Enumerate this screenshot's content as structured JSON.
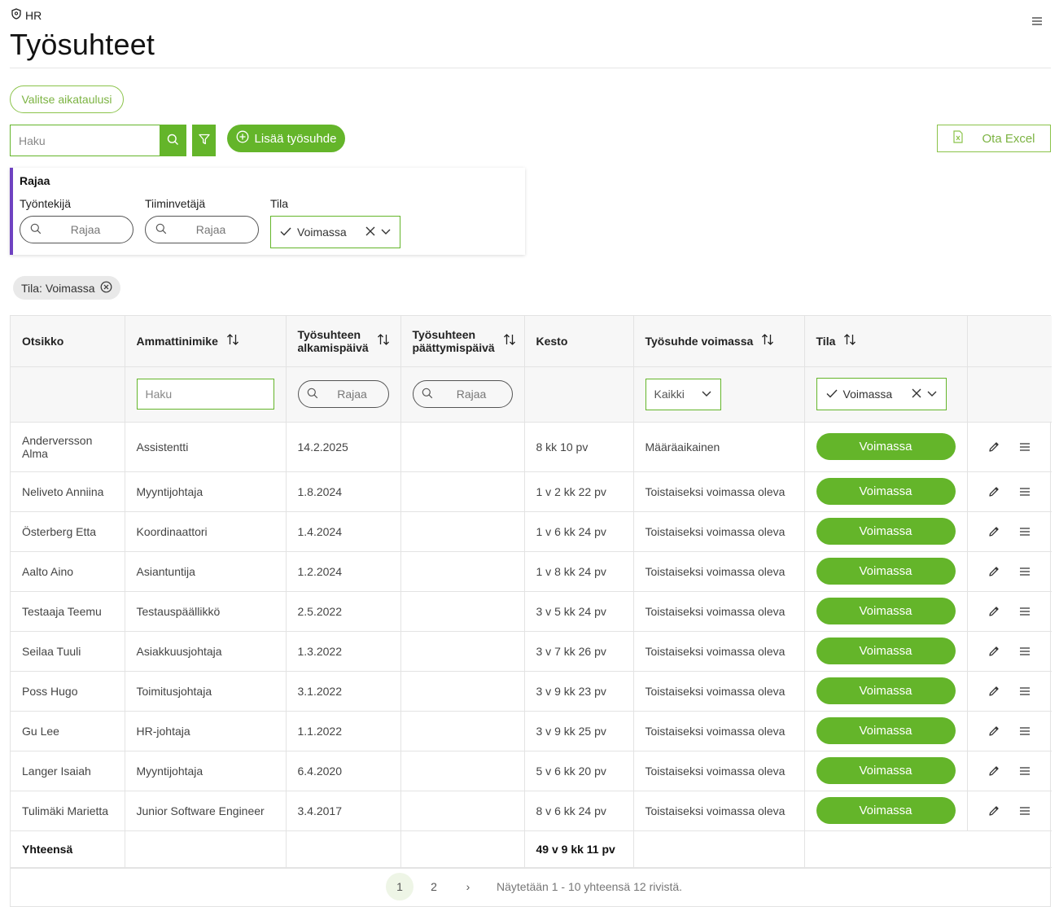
{
  "breadcrumb": {
    "label": "HR"
  },
  "page": {
    "title": "Työsuhteet"
  },
  "schedule_button": "Valitse aikataulusi",
  "search": {
    "placeholder": "Haku"
  },
  "add_button": "Lisää työsuhde",
  "excel_button": "Ota Excel",
  "filter_card": {
    "title": "Rajaa",
    "employee_label": "Työntekijä",
    "employee_placeholder": "Rajaa",
    "lead_label": "Tiiminvetäjä",
    "lead_placeholder": "Rajaa",
    "status_label": "Tila",
    "status_value": "Voimassa"
  },
  "chip": {
    "label": "Tila: Voimassa"
  },
  "table": {
    "headers": {
      "title": "Otsikko",
      "job": "Ammattinimike",
      "start": "Työsuhteen alkamispäivä",
      "end": "Työsuhteen päättymispäivä",
      "duration": "Kesto",
      "contract": "Työsuhde voimassa",
      "status": "Tila"
    },
    "filters": {
      "job_placeholder": "Haku",
      "start_placeholder": "Rajaa",
      "end_placeholder": "Rajaa",
      "contract_value": "Kaikki",
      "status_value": "Voimassa"
    },
    "rows": [
      {
        "name": "Anderversson Alma",
        "job": "Assistentti",
        "start": "14.2.2025",
        "end": "",
        "duration": "8 kk 10 pv",
        "contract": "Määräaikainen",
        "status": "Voimassa"
      },
      {
        "name": "Neliveto Anniina",
        "job": "Myyntijohtaja",
        "start": "1.8.2024",
        "end": "",
        "duration": "1 v 2 kk 22 pv",
        "contract": "Toistaiseksi voimassa oleva",
        "status": "Voimassa"
      },
      {
        "name": "Österberg Etta",
        "job": "Koordinaattori",
        "start": "1.4.2024",
        "end": "",
        "duration": "1 v 6 kk 24 pv",
        "contract": "Toistaiseksi voimassa oleva",
        "status": "Voimassa"
      },
      {
        "name": "Aalto Aino",
        "job": "Asiantuntija",
        "start": "1.2.2024",
        "end": "",
        "duration": "1 v 8 kk 24 pv",
        "contract": "Toistaiseksi voimassa oleva",
        "status": "Voimassa"
      },
      {
        "name": "Testaaja Teemu",
        "job": "Testauspäällikkö",
        "start": "2.5.2022",
        "end": "",
        "duration": "3 v 5 kk 24 pv",
        "contract": "Toistaiseksi voimassa oleva",
        "status": "Voimassa"
      },
      {
        "name": "Seilaa Tuuli",
        "job": "Asiakkuusjohtaja",
        "start": "1.3.2022",
        "end": "",
        "duration": "3 v 7 kk 26 pv",
        "contract": "Toistaiseksi voimassa oleva",
        "status": "Voimassa"
      },
      {
        "name": "Poss Hugo",
        "job": "Toimitusjohtaja",
        "start": "3.1.2022",
        "end": "",
        "duration": "3 v 9 kk 23 pv",
        "contract": "Toistaiseksi voimassa oleva",
        "status": "Voimassa"
      },
      {
        "name": "Gu Lee",
        "job": "HR-johtaja",
        "start": "1.1.2022",
        "end": "",
        "duration": "3 v 9 kk 25 pv",
        "contract": "Toistaiseksi voimassa oleva",
        "status": "Voimassa"
      },
      {
        "name": "Langer Isaiah",
        "job": "Myyntijohtaja",
        "start": "6.4.2020",
        "end": "",
        "duration": "5 v 6 kk 20 pv",
        "contract": "Toistaiseksi voimassa oleva",
        "status": "Voimassa"
      },
      {
        "name": "Tulimäki Marietta",
        "job": "Junior Software Engineer",
        "start": "3.4.2017",
        "end": "",
        "duration": "8 v 6 kk 24 pv",
        "contract": "Toistaiseksi voimassa oleva",
        "status": "Voimassa"
      }
    ],
    "footer": {
      "label": "Yhteensä",
      "total_duration": "49 v 9 kk 11 pv"
    }
  },
  "pagination": {
    "pages": [
      "1",
      "2"
    ],
    "next": "›",
    "info": "Näytetään 1 - 10 yhteensä 12 rivistä."
  },
  "colors": {
    "accent": "#64b52a",
    "filter_border": "#6f42c1"
  },
  "icons": [
    "shield-icon",
    "hamburger-icon",
    "search-icon",
    "filter-icon",
    "plus-circle-icon",
    "excel-file-icon",
    "check-icon",
    "clear-icon",
    "chevron-down-icon",
    "sort-icon",
    "close-circle-icon",
    "pencil-icon",
    "row-menu-icon"
  ]
}
